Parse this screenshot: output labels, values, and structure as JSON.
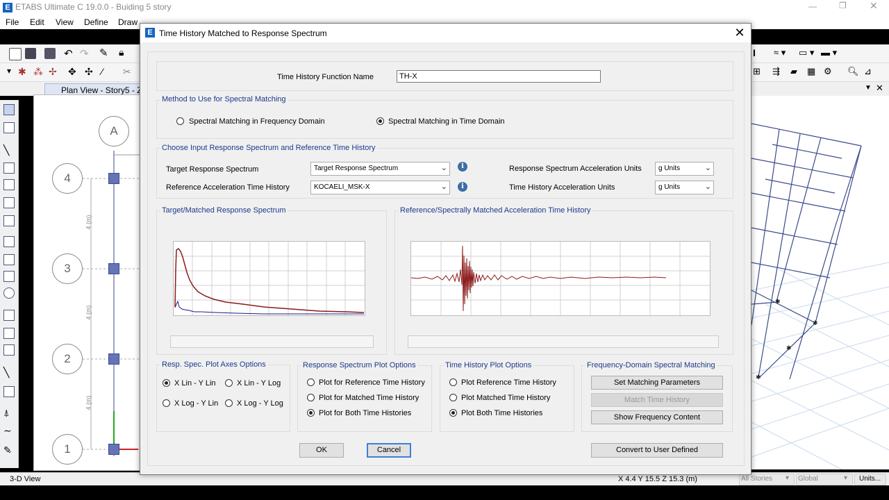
{
  "app": {
    "title": "ETABS Ultimate C 19.0.0 - Buiding 5 story",
    "menu": [
      "File",
      "Edit",
      "View",
      "Define",
      "Draw"
    ],
    "plan_tab": "Plan View - Story5 - Z =",
    "grid_labels": {
      "col_a": "A",
      "rows": [
        "4",
        "3",
        "2",
        "1"
      ]
    },
    "dim_labels": [
      "4 (m)",
      "4 (m)",
      "4 (m)"
    ],
    "status": {
      "view": "3-D View",
      "coords": "X 4.4  Y 15.5  Z 15.3 (m)",
      "stories": "All Stories",
      "global": "Global",
      "units": "Units..."
    }
  },
  "dialog": {
    "title": "Time History Matched to Response Spectrum",
    "function_name_label": "Time History Function Name",
    "function_name_value": "TH-X",
    "method": {
      "title": "Method to Use for Spectral Matching",
      "options": [
        {
          "label": "Spectral Matching in Frequency Domain",
          "selected": false
        },
        {
          "label": "Spectral Matching in Time Domain",
          "selected": true
        }
      ]
    },
    "input": {
      "title": "Choose Input Response Spectrum and Reference Time History",
      "target_label": "Target Response Spectrum",
      "target_value": "Target Response Spectrum",
      "reference_label": "Reference Acceleration Time History",
      "reference_value": "KOCAELI_MSK-X",
      "rs_units_label": "Response Spectrum Acceleration Units",
      "rs_units_value": "g Units",
      "th_units_label": "Time History Acceleration Units",
      "th_units_value": "g Units"
    },
    "plots": {
      "left_title": "Target/Matched Response Spectrum",
      "right_title": "Reference/Spectrally Matched Acceleration Time History"
    },
    "axes_options": {
      "title": "Resp. Spec. Plot Axes Options",
      "options": [
        {
          "label": "X Lin - Y Lin",
          "selected": true
        },
        {
          "label": "X Lin - Y Log",
          "selected": false
        },
        {
          "label": "X Log - Y Lin",
          "selected": false
        },
        {
          "label": "X Log - Y Log",
          "selected": false
        }
      ]
    },
    "rs_plot_options": {
      "title": "Response Spectrum Plot Options",
      "options": [
        {
          "label": "Plot for Reference Time History",
          "selected": false
        },
        {
          "label": "Plot for Matched Time History",
          "selected": false
        },
        {
          "label": "Plot for Both Time Histories",
          "selected": true
        }
      ]
    },
    "th_plot_options": {
      "title": "Time History Plot Options",
      "options": [
        {
          "label": "Plot Reference Time History",
          "selected": false
        },
        {
          "label": "Plot Matched Time History",
          "selected": false
        },
        {
          "label": "Plot Both Time Histories",
          "selected": true
        }
      ]
    },
    "freq_domain": {
      "title": "Frequency-Domain Spectral Matching",
      "set_params": "Set Matching Parameters",
      "match": "Match Time History",
      "show_freq": "Show Frequency Content"
    },
    "buttons": {
      "ok": "OK",
      "cancel": "Cancel",
      "convert": "Convert to User Defined"
    }
  },
  "colors": {
    "accent": "#1a3a8a",
    "matched_series": "#8b1a1a",
    "reference_series": "#1a1a8b",
    "structure_lines": "#3a4a8a"
  }
}
